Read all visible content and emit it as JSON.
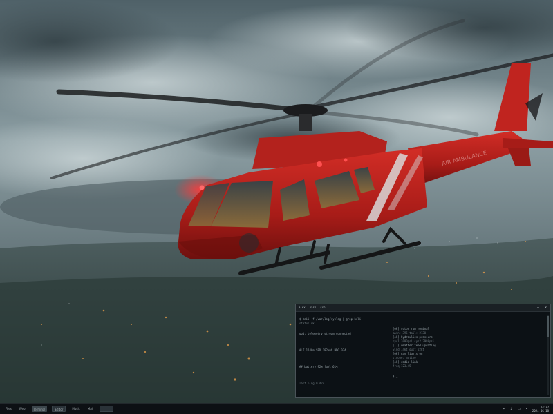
{
  "wallpaper": {
    "fuselage_text": "AIR AMBULANCE"
  },
  "terminal": {
    "tabs": [
      "alex",
      "bash",
      "ssh"
    ],
    "left_lines": [
      "$ tail -f /var/log/syslog | grep heli",
      "  status ok",
      "",
      "  upd: telemetry stream connected",
      "",
      "  ALT 1240m  SPD 182kmh  HDG 074",
      "",
      "  ## battery 92%  fuel 61%",
      "",
      "  last ping 0.42s"
    ],
    "right_lines": [
      "[ok] rotor rpm nominal",
      "  main: 395  tail: 2130",
      "[ok] hydraulics pressure",
      "  sys1 3000psi sys2 2980psi",
      "[..] weather feed updating",
      "  wind 14kt gust 22kt",
      "[ok] nav lights on",
      "  strobe: active",
      "[ok] radio link",
      "  freq 123.45",
      "",
      "  $ _"
    ]
  },
  "taskbar": {
    "items": [
      {
        "label": "Files",
        "kind": "launcher"
      },
      {
        "label": "Web",
        "kind": "launcher"
      },
      {
        "label": "Terminal",
        "kind": "window"
      },
      {
        "label": "Editor",
        "kind": "window"
      },
      {
        "label": "Music",
        "kind": "launcher"
      },
      {
        "label": "Mail",
        "kind": "launcher"
      },
      {
        "label": "",
        "kind": "window"
      }
    ],
    "tray_icons": [
      "network-icon",
      "volume-icon",
      "battery-icon",
      "bell-icon"
    ],
    "clock_time": "14:32",
    "clock_date": "2024-06-18"
  },
  "colors": {
    "helicopter_red": "#b5201c",
    "terminal_bg": "#0a0e12",
    "taskbar_bg": "#0d1014"
  }
}
